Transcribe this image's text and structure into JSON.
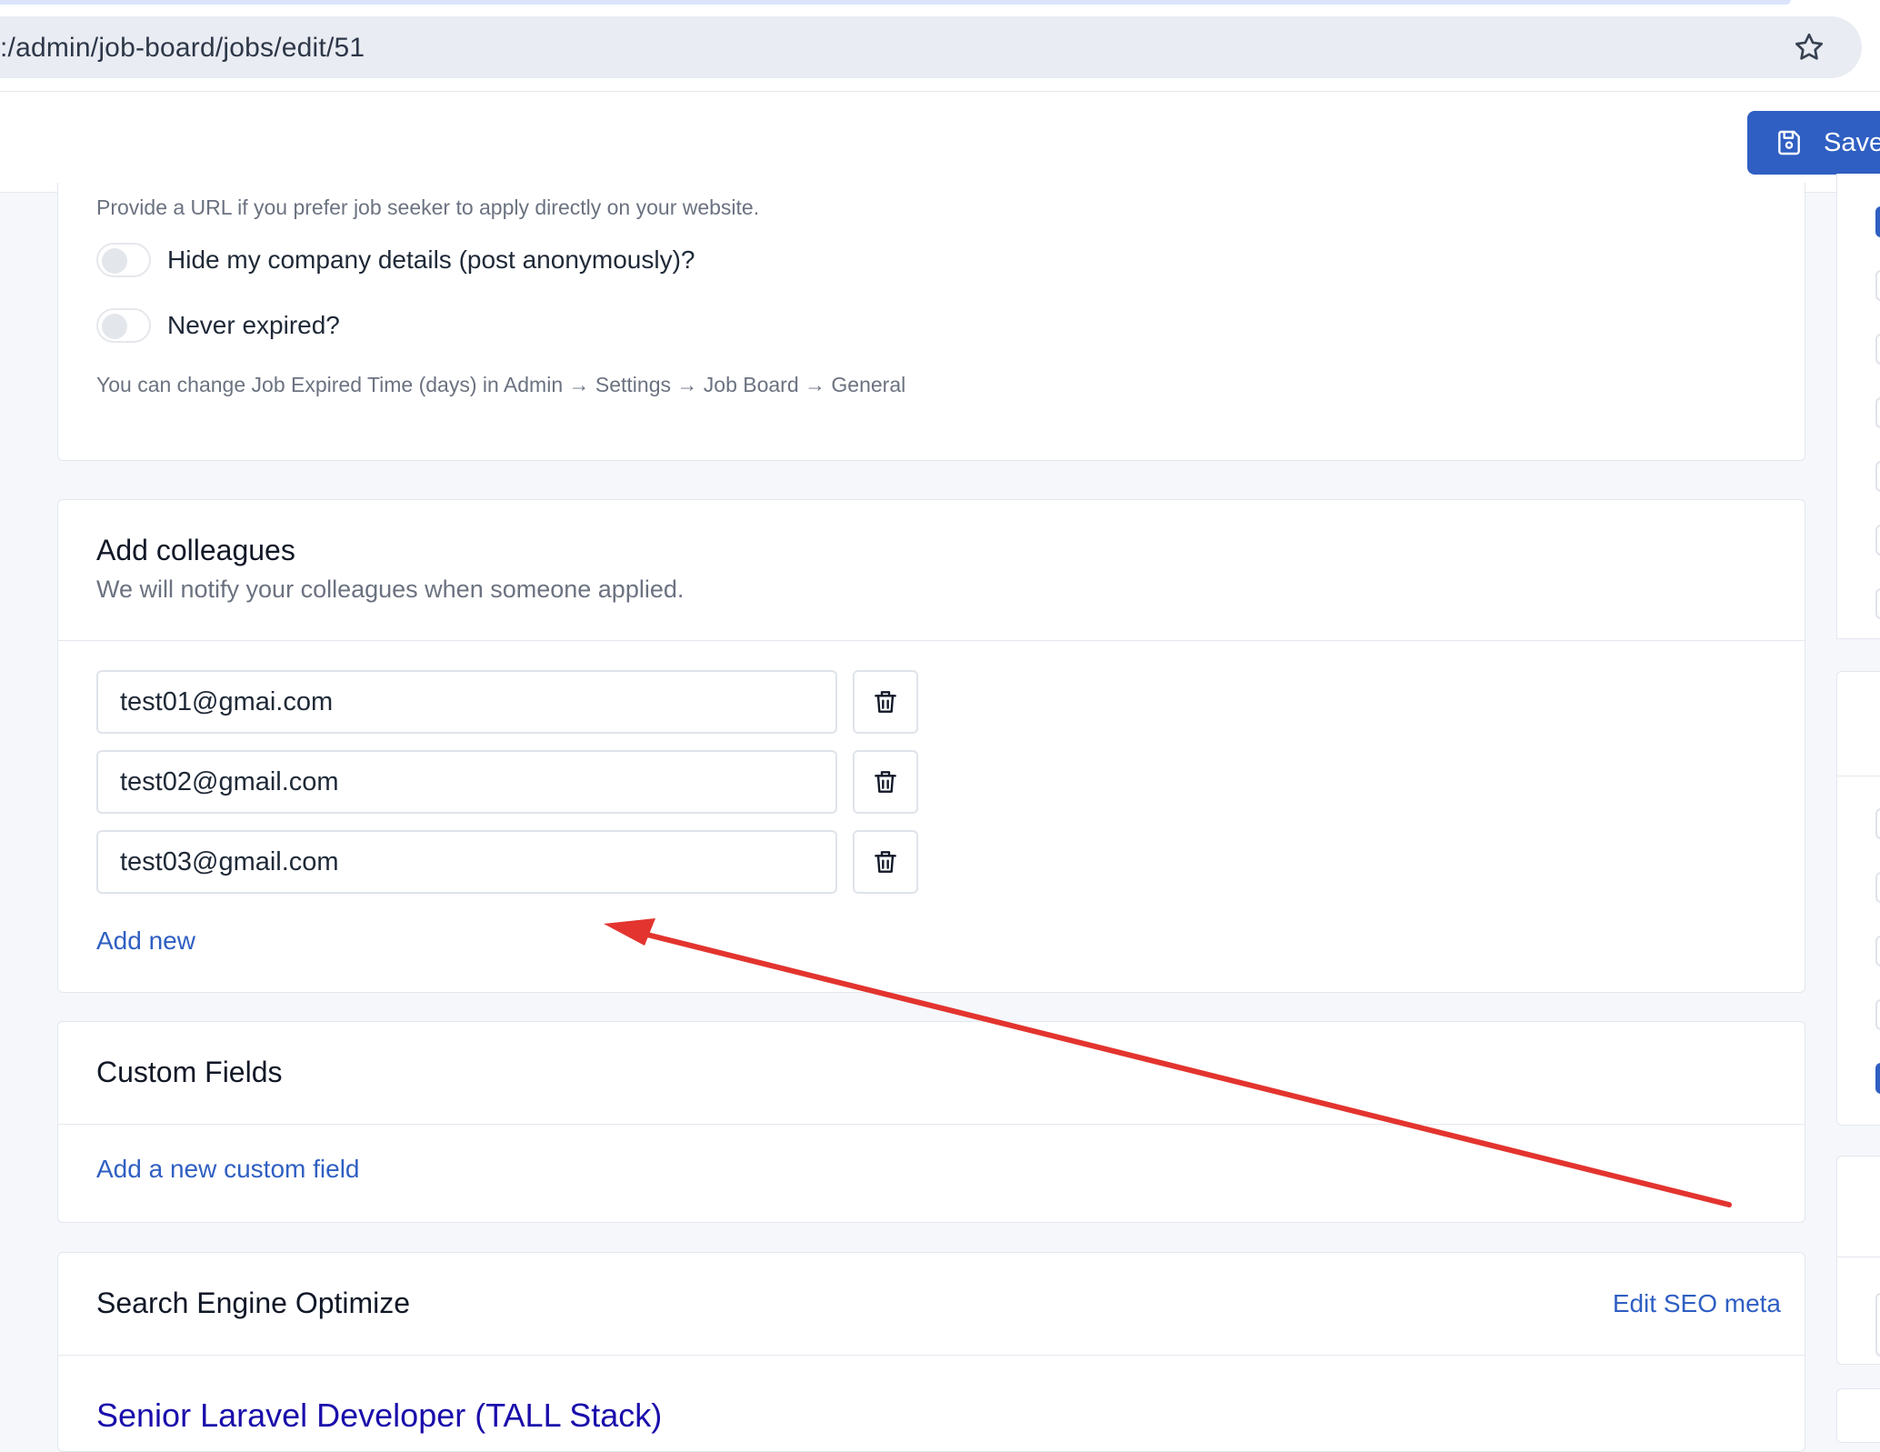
{
  "browser": {
    "url": ":/admin/job-board/jobs/edit/51"
  },
  "toolbar": {
    "save_label": "Save"
  },
  "apply_section": {
    "url_help": "Provide a URL if you prefer job seeker to apply directly on your website.",
    "hide_company_label": "Hide my company details (post anonymously)?",
    "hide_company_checked": false,
    "never_expired_label": "Never expired?",
    "never_expired_checked": false,
    "expire_help": "You can change Job Expired Time (days) in Admin → Settings → Job Board → General"
  },
  "colleagues": {
    "title": "Add colleagues",
    "subtitle": "We will notify your colleagues when someone applied.",
    "emails": [
      "test01@gmai.com",
      "test02@gmail.com",
      "test03@gmail.com"
    ],
    "add_new_label": "Add new"
  },
  "custom_fields": {
    "title": "Custom Fields",
    "add_label": "Add a new custom field"
  },
  "seo": {
    "title": "Search Engine Optimize",
    "edit_label": "Edit SEO meta",
    "preview_title": "Senior Laravel Developer (TALL Stack)"
  },
  "icons": {
    "bookmark": "star-icon",
    "save": "floppy-disk-icon",
    "delete": "trash-icon"
  },
  "colors": {
    "primary": "#2f5fc2",
    "annotation_arrow": "#e3342f",
    "seo_link": "#1a0dab"
  }
}
